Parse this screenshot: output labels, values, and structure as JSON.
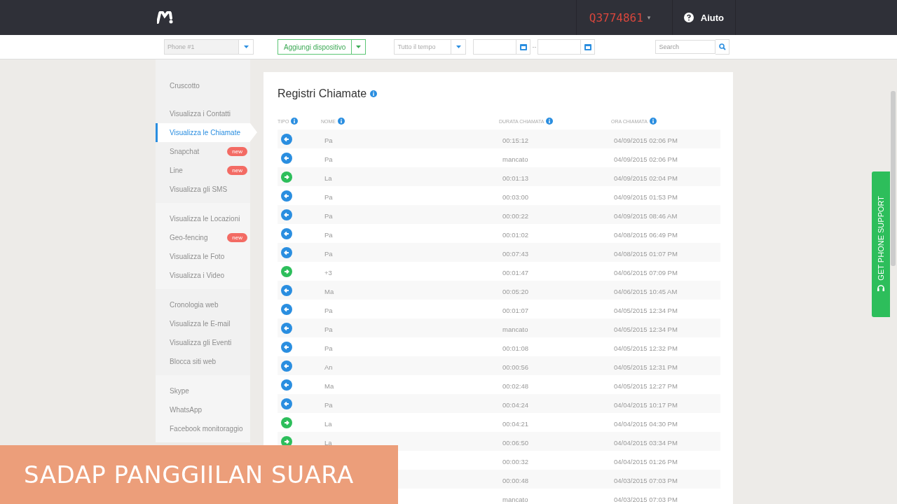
{
  "topbar": {
    "account": "Q3774861",
    "account_caret": "▾",
    "help": "Aiuto"
  },
  "toolbar": {
    "device": {
      "placeholder": "Phone #1"
    },
    "add_device": "Aggiungi dispositivo",
    "period": "Tutto il tempo",
    "date_separator": "--",
    "search": {
      "placeholder": "Search"
    }
  },
  "sidebar": {
    "groups": [
      {
        "items": [
          {
            "label": "Cruscotto",
            "selected": false
          },
          {
            "label": "Visualizza i Contatti",
            "selected": false
          },
          {
            "label": "Visualizza le Chiamate",
            "selected": true
          },
          {
            "label": "Snapchat",
            "selected": false,
            "badge": "new"
          },
          {
            "label": "Line",
            "selected": false,
            "badge": "new"
          },
          {
            "label": "Visualizza gli SMS",
            "selected": false
          }
        ]
      },
      {
        "items": [
          {
            "label": "Visualizza le Locazioni",
            "selected": false
          },
          {
            "label": "Geo-fencing",
            "selected": false,
            "badge": "new"
          },
          {
            "label": "Visualizza le Foto",
            "selected": false
          },
          {
            "label": "Visualizza i Video",
            "selected": false
          }
        ]
      },
      {
        "items": [
          {
            "label": "Cronologia web",
            "selected": false
          },
          {
            "label": "Visualizza le E-mail",
            "selected": false
          },
          {
            "label": "Visualizza gli Eventi",
            "selected": false
          },
          {
            "label": "Blocca siti web",
            "selected": false
          }
        ]
      },
      {
        "items": [
          {
            "label": "Skype",
            "selected": false
          },
          {
            "label": "WhatsApp",
            "selected": false
          },
          {
            "label": "Facebook monitoraggio",
            "selected": false
          }
        ]
      }
    ]
  },
  "panel": {
    "title": "Registri Chiamate",
    "columns": [
      "TIPO",
      "NOME",
      "DURATA CHIAMATA",
      "ORA CHIAMATA"
    ],
    "rows": [
      {
        "kind": "incoming",
        "name": "Pa",
        "duration": "00:15:12",
        "time": "04/09/2015 02:06 PM"
      },
      {
        "kind": "incoming",
        "name": "Pa",
        "duration": "mancato",
        "time": "04/09/2015 02:06 PM"
      },
      {
        "kind": "outgoing",
        "name": "La",
        "duration": "00:01:13",
        "time": "04/09/2015 02:04 PM"
      },
      {
        "kind": "incoming",
        "name": "Pa",
        "duration": "00:03:00",
        "time": "04/09/2015 01:53 PM"
      },
      {
        "kind": "incoming",
        "name": "Pa",
        "duration": "00:00:22",
        "time": "04/09/2015 08:46 AM"
      },
      {
        "kind": "incoming",
        "name": "Pa",
        "duration": "00:01:02",
        "time": "04/08/2015 06:49 PM"
      },
      {
        "kind": "incoming",
        "name": "Pa",
        "duration": "00:07:43",
        "time": "04/08/2015 01:07 PM"
      },
      {
        "kind": "outgoing",
        "name": "+3",
        "duration": "00:01:47",
        "time": "04/06/2015 07:09 PM"
      },
      {
        "kind": "incoming",
        "name": "Ma",
        "duration": "00:05:20",
        "time": "04/06/2015 10:45 AM"
      },
      {
        "kind": "incoming",
        "name": "Pa",
        "duration": "00:01:07",
        "time": "04/05/2015 12:34 PM"
      },
      {
        "kind": "incoming",
        "name": "Pa",
        "duration": "mancato",
        "time": "04/05/2015 12:34 PM"
      },
      {
        "kind": "incoming",
        "name": "Pa",
        "duration": "00:01:08",
        "time": "04/05/2015 12:32 PM"
      },
      {
        "kind": "incoming",
        "name": "An",
        "duration": "00:00:56",
        "time": "04/05/2015 12:31 PM"
      },
      {
        "kind": "incoming",
        "name": "Ma",
        "duration": "00:02:48",
        "time": "04/05/2015 12:27 PM"
      },
      {
        "kind": "incoming",
        "name": "Pa",
        "duration": "00:04:24",
        "time": "04/04/2015 10:17 PM"
      },
      {
        "kind": "outgoing",
        "name": "La",
        "duration": "00:04:21",
        "time": "04/04/2015 04:30 PM"
      },
      {
        "kind": "outgoing",
        "name": "La",
        "duration": "00:06:50",
        "time": "04/04/2015 03:34 PM"
      },
      {
        "kind": "covered",
        "duration": "00:00:32",
        "time": "04/04/2015 01:26 PM"
      },
      {
        "kind": "covered",
        "duration": "00:00:48",
        "time": "04/03/2015 07:03 PM"
      },
      {
        "kind": "covered",
        "duration": "mancato",
        "time": "04/03/2015 07:03 PM"
      }
    ]
  },
  "support_tab": "GET PHONE SUPPORT",
  "caption_banner": "SADAP PANGGIILAN SUARA"
}
